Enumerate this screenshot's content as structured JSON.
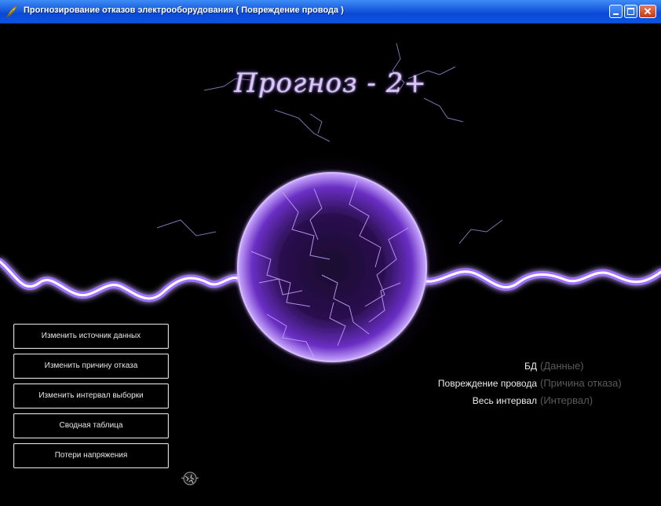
{
  "window": {
    "title": "Прогнозирование отказов электрооборудования ( Повреждение провода )",
    "icon": "feather-app-icon",
    "controls": {
      "minimize_icon": "minimize-icon",
      "maximize_icon": "maximize-icon",
      "close_glyph": "✕"
    }
  },
  "logo": {
    "text": "Прогноз - 2+"
  },
  "menu": {
    "buttons": [
      {
        "label": "Изменить источник данных"
      },
      {
        "label": "Изменить причину отказа"
      },
      {
        "label": "Изменить интервал выборки"
      },
      {
        "label": "Сводная таблица"
      },
      {
        "label": "Потери напряжения"
      }
    ]
  },
  "info": {
    "rows": [
      {
        "label": "БД",
        "value": "(Данные)"
      },
      {
        "label": "Повреждение провода",
        "value": "(Причина отказа)"
      },
      {
        "label": "Весь интервал",
        "value": "(Интервал)"
      }
    ]
  },
  "colors": {
    "titlebar": "#0a49d6",
    "background": "#000000",
    "lightning": "#b58cff",
    "glow": "#7a3fe0",
    "button_border": "#d8d8d8",
    "info_label": "#ececec",
    "info_value": "#5a5a5a"
  }
}
